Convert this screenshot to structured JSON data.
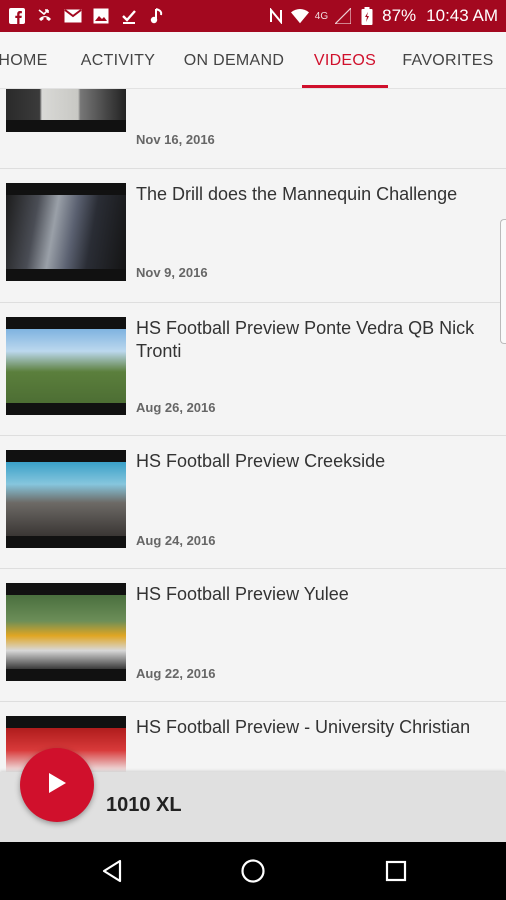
{
  "status_bar": {
    "network_label": "4G",
    "battery": "87%",
    "time": "10:43 AM",
    "icons": [
      "facebook-icon",
      "missed-call-icon",
      "gmail-icon",
      "image-icon",
      "download-done-icon",
      "music-icon",
      "nfc-icon",
      "wifi-icon",
      "signal-icon",
      "battery-icon"
    ]
  },
  "tabs": [
    {
      "label": "HOME"
    },
    {
      "label": "ACTIVITY"
    },
    {
      "label": "ON DEMAND"
    },
    {
      "label": "VIDEOS"
    },
    {
      "label": "FAVORITES"
    }
  ],
  "active_tab": "VIDEOS",
  "videos": [
    {
      "title": "",
      "date": "Nov 16, 2016"
    },
    {
      "title": "The Drill does the Mannequin Challenge",
      "date": "Nov 9, 2016"
    },
    {
      "title": "HS Football Preview   Ponte Vedra QB Nick Tronti",
      "date": "Aug 26, 2016"
    },
    {
      "title": "HS Football Preview   Creekside",
      "date": "Aug 24, 2016"
    },
    {
      "title": "HS Football Preview Yulee",
      "date": "Aug 22, 2016"
    },
    {
      "title": "HS Football Preview - University Christian",
      "date": ""
    }
  ],
  "player": {
    "station": "1010 XL",
    "play_icon": "play-icon"
  },
  "nav_bar": {
    "icons": [
      "back-icon",
      "home-icon",
      "recents-icon"
    ]
  },
  "colors": {
    "accent": "#d0102c",
    "status_bar": "#a3081f"
  }
}
